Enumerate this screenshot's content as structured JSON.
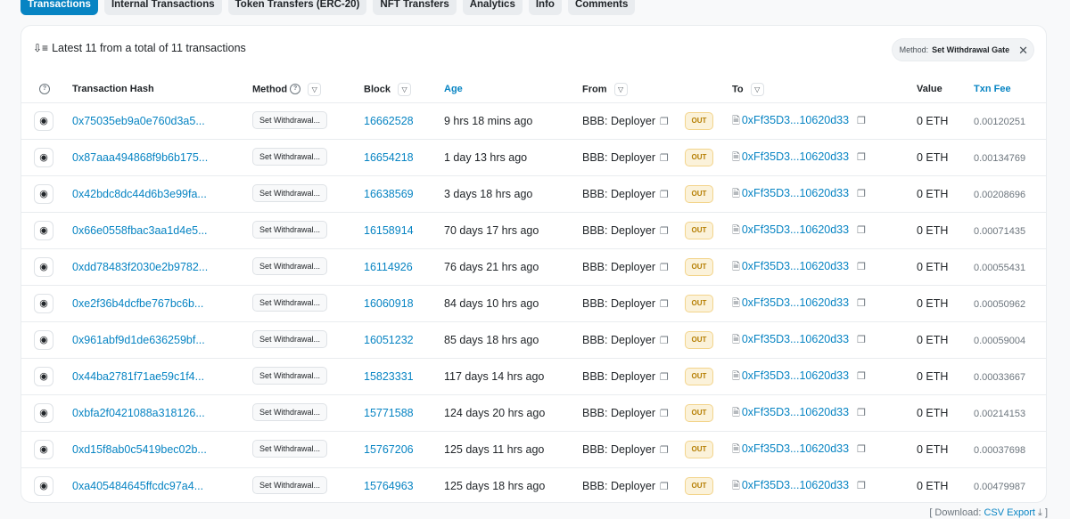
{
  "tabs": [
    {
      "label": "Transactions",
      "active": true
    },
    {
      "label": "Internal Transactions"
    },
    {
      "label": "Token Transfers (ERC-20)"
    },
    {
      "label": "NFT Transfers"
    },
    {
      "label": "Analytics"
    },
    {
      "label": "Info"
    },
    {
      "label": "Comments"
    }
  ],
  "summary": {
    "text": "Latest 11 from a total of 11 transactions",
    "icon": "sort-icon"
  },
  "filter": {
    "key": "Method:",
    "value": "Set Withdrawal Gate",
    "close": "✕"
  },
  "columns": {
    "hash": "Transaction Hash",
    "method": "Method",
    "block": "Block",
    "age": "Age",
    "from": "From",
    "to": "To",
    "value": "Value",
    "fee": "Txn Fee"
  },
  "rows": [
    {
      "hash": "0x75035eb9a0e760d3a5...",
      "method": "Set Withdrawal...",
      "block": "16662528",
      "age": "9 hrs 18 mins ago",
      "from": "BBB: Deployer",
      "direction": "OUT",
      "to": "0xFf35D3...10620d33",
      "value": "0 ETH",
      "fee": "0.00120251"
    },
    {
      "hash": "0x87aaa494868f9b6b175...",
      "method": "Set Withdrawal...",
      "block": "16654218",
      "age": "1 day 13 hrs ago",
      "from": "BBB: Deployer",
      "direction": "OUT",
      "to": "0xFf35D3...10620d33",
      "value": "0 ETH",
      "fee": "0.00134769"
    },
    {
      "hash": "0x42bdc8dc44d6b3e99fa...",
      "method": "Set Withdrawal...",
      "block": "16638569",
      "age": "3 days 18 hrs ago",
      "from": "BBB: Deployer",
      "direction": "OUT",
      "to": "0xFf35D3...10620d33",
      "value": "0 ETH",
      "fee": "0.00208696"
    },
    {
      "hash": "0x66e0558fbac3aa1d4e5...",
      "method": "Set Withdrawal...",
      "block": "16158914",
      "age": "70 days 17 hrs ago",
      "from": "BBB: Deployer",
      "direction": "OUT",
      "to": "0xFf35D3...10620d33",
      "value": "0 ETH",
      "fee": "0.00071435"
    },
    {
      "hash": "0xdd78483f2030e2b9782...",
      "method": "Set Withdrawal...",
      "block": "16114926",
      "age": "76 days 21 hrs ago",
      "from": "BBB: Deployer",
      "direction": "OUT",
      "to": "0xFf35D3...10620d33",
      "value": "0 ETH",
      "fee": "0.00055431"
    },
    {
      "hash": "0xe2f36b4dcfbe767bc6b...",
      "method": "Set Withdrawal...",
      "block": "16060918",
      "age": "84 days 10 hrs ago",
      "from": "BBB: Deployer",
      "direction": "OUT",
      "to": "0xFf35D3...10620d33",
      "value": "0 ETH",
      "fee": "0.00050962"
    },
    {
      "hash": "0x961abf9d1de636259bf...",
      "method": "Set Withdrawal...",
      "block": "16051232",
      "age": "85 days 18 hrs ago",
      "from": "BBB: Deployer",
      "direction": "OUT",
      "to": "0xFf35D3...10620d33",
      "value": "0 ETH",
      "fee": "0.00059004"
    },
    {
      "hash": "0x44ba2781f71ae59c1f4...",
      "method": "Set Withdrawal...",
      "block": "15823331",
      "age": "117 days 14 hrs ago",
      "from": "BBB: Deployer",
      "direction": "OUT",
      "to": "0xFf35D3...10620d33",
      "value": "0 ETH",
      "fee": "0.00033667"
    },
    {
      "hash": "0xbfa2f0421088a318126...",
      "method": "Set Withdrawal...",
      "block": "15771588",
      "age": "124 days 20 hrs ago",
      "from": "BBB: Deployer",
      "direction": "OUT",
      "to": "0xFf35D3...10620d33",
      "value": "0 ETH",
      "fee": "0.00214153"
    },
    {
      "hash": "0xd15f8ab0c5419bec02b...",
      "method": "Set Withdrawal...",
      "block": "15767206",
      "age": "125 days 11 hrs ago",
      "from": "BBB: Deployer",
      "direction": "OUT",
      "to": "0xFf35D3...10620d33",
      "value": "0 ETH",
      "fee": "0.00037698"
    },
    {
      "hash": "0xa405484645ffcdc97a4...",
      "method": "Set Withdrawal...",
      "block": "15764963",
      "age": "125 days 18 hrs ago",
      "from": "BBB: Deployer",
      "direction": "OUT",
      "to": "0xFf35D3...10620d33",
      "value": "0 ETH",
      "fee": "0.00479987"
    }
  ],
  "footer": {
    "prefix": "[ Download:",
    "link": "CSV Export",
    "suffix": "]"
  },
  "colors": {
    "accent": "#0784c3",
    "out_badge": "#fbf2da",
    "out_text": "#b47d00"
  }
}
